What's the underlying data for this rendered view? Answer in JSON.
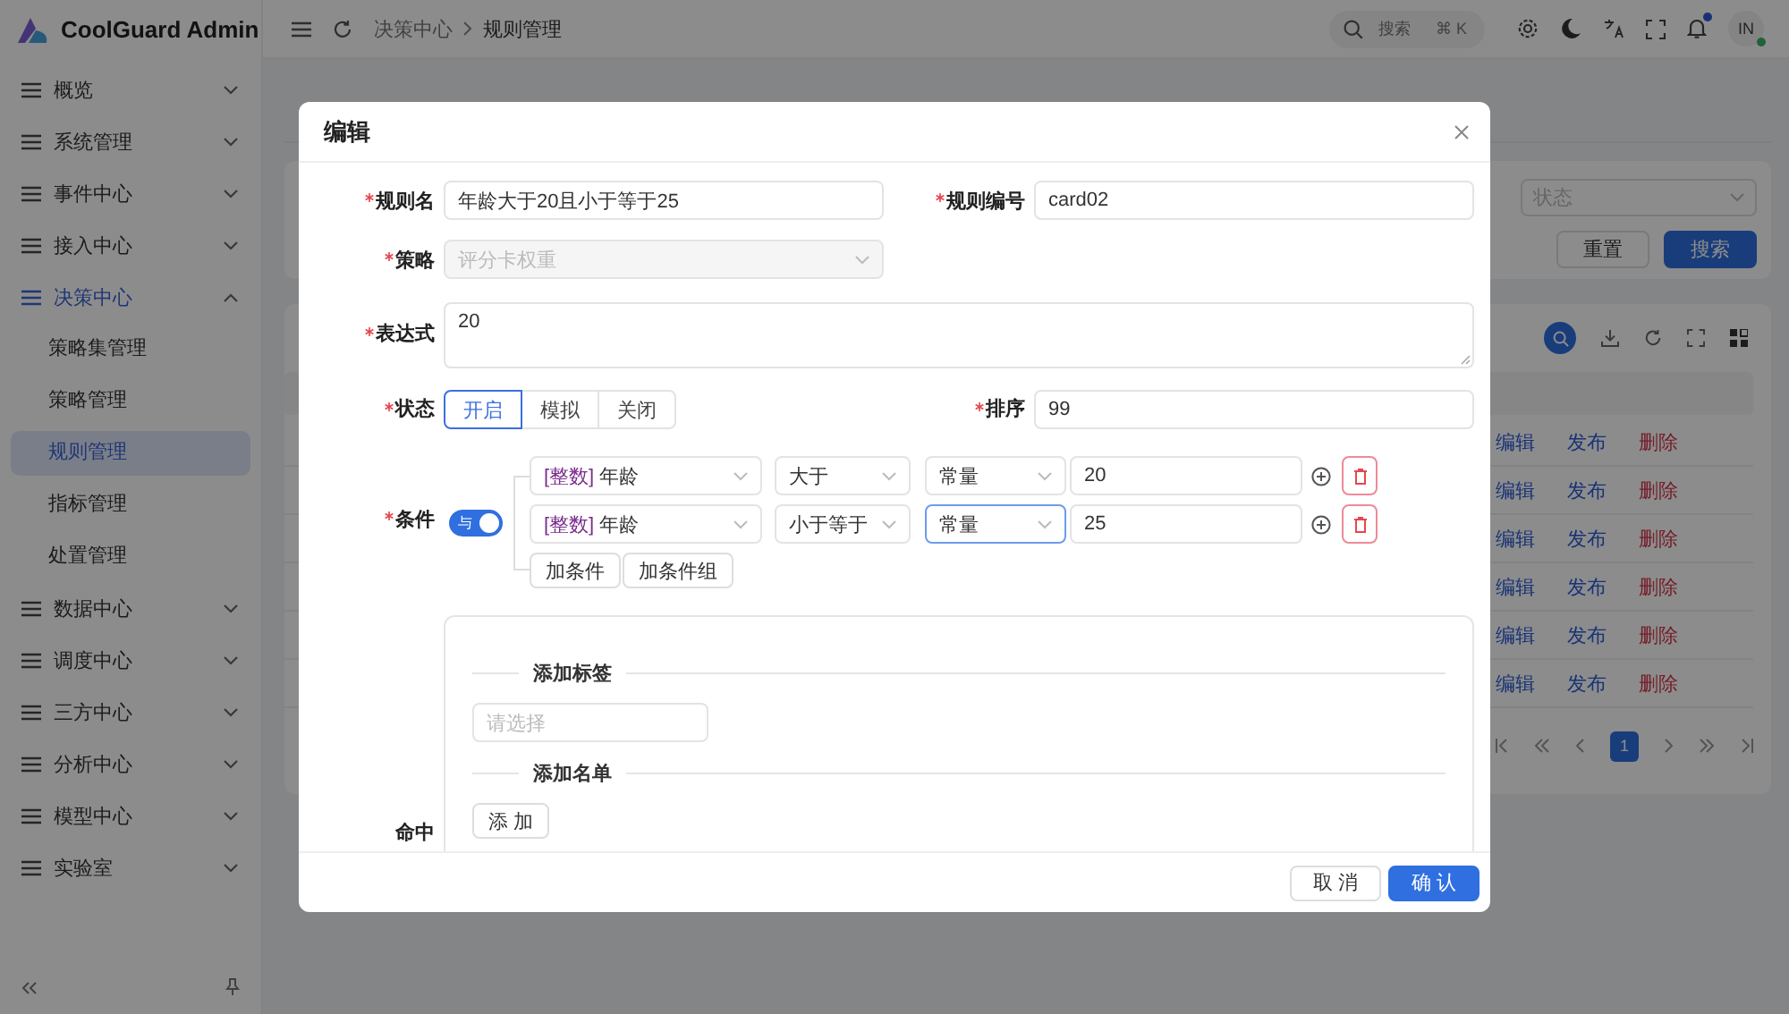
{
  "app": {
    "title": "CoolGuard Admin"
  },
  "header": {
    "breadcrumb": [
      "决策中心",
      "规则管理"
    ],
    "search": {
      "placeholder": "搜索",
      "shortcut": "⌘ K"
    },
    "unread": true,
    "avatar": {
      "initials": "IN",
      "online": true
    }
  },
  "sidebar": {
    "items": [
      {
        "label": "概览",
        "expanded": false
      },
      {
        "label": "系统管理",
        "expanded": false
      },
      {
        "label": "事件中心",
        "expanded": false
      },
      {
        "label": "接入中心",
        "expanded": false
      },
      {
        "label": "决策中心",
        "expanded": true,
        "children": [
          {
            "label": "策略集管理",
            "selected": false
          },
          {
            "label": "策略管理",
            "selected": false
          },
          {
            "label": "规则管理",
            "selected": true
          },
          {
            "label": "指标管理",
            "selected": false
          },
          {
            "label": "处置管理",
            "selected": false
          }
        ]
      },
      {
        "label": "数据中心",
        "expanded": false
      },
      {
        "label": "调度中心",
        "expanded": false
      },
      {
        "label": "三方中心",
        "expanded": false
      },
      {
        "label": "分析中心",
        "expanded": false
      },
      {
        "label": "模型中心",
        "expanded": false
      },
      {
        "label": "实验室",
        "expanded": false
      }
    ]
  },
  "content": {
    "filter": {
      "status_placeholder": "状态",
      "buttons": [
        {
          "label": "重置",
          "kind": "default"
        },
        {
          "label": "搜索",
          "kind": "primary"
        }
      ]
    },
    "table": {
      "rows": [
        {
          "actions": [
            {
              "label": "编辑",
              "kind": "link"
            },
            {
              "label": "发布",
              "kind": "link"
            },
            {
              "label": "删除",
              "kind": "danger"
            }
          ]
        },
        {
          "actions": [
            {
              "label": "编辑",
              "kind": "link"
            },
            {
              "label": "发布",
              "kind": "link"
            },
            {
              "label": "删除",
              "kind": "danger"
            }
          ]
        },
        {
          "actions": [
            {
              "label": "编辑",
              "kind": "link"
            },
            {
              "label": "发布",
              "kind": "link"
            },
            {
              "label": "删除",
              "kind": "danger"
            }
          ]
        },
        {
          "actions": [
            {
              "label": "编辑",
              "kind": "link"
            },
            {
              "label": "发布",
              "kind": "link"
            },
            {
              "label": "删除",
              "kind": "danger"
            }
          ]
        },
        {
          "actions": [
            {
              "label": "编辑",
              "kind": "link"
            },
            {
              "label": "发布",
              "kind": "link"
            },
            {
              "label": "删除",
              "kind": "danger"
            }
          ]
        },
        {
          "actions": [
            {
              "label": "编辑",
              "kind": "link"
            },
            {
              "label": "发布",
              "kind": "link"
            },
            {
              "label": "删除",
              "kind": "danger"
            }
          ]
        }
      ]
    },
    "pagination": {
      "pages": [
        {
          "label": "1",
          "selected": true
        }
      ]
    }
  },
  "dialog": {
    "title": "编辑",
    "rule_name": {
      "label": "规则名",
      "required": true,
      "value": "年龄大于20且小于等于25"
    },
    "rule_code": {
      "label": "规则编号",
      "required": true,
      "value": "card02"
    },
    "strategy": {
      "label": "策略",
      "required": true,
      "value": "评分卡权重",
      "disabled": true
    },
    "expression": {
      "label": "表达式",
      "required": true,
      "value": "20"
    },
    "status": {
      "label": "状态",
      "required": true,
      "options": [
        {
          "label": "开启",
          "selected": true
        },
        {
          "label": "模拟",
          "selected": false
        },
        {
          "label": "关闭",
          "selected": false
        }
      ]
    },
    "order": {
      "label": "排序",
      "required": true,
      "value": "99"
    },
    "conditions": {
      "label": "条件",
      "required": true,
      "logic": {
        "label": "与",
        "on": true
      },
      "rows": [
        {
          "field_type": "[整数]",
          "field": "年龄",
          "operator": "大于",
          "value_type": "常量",
          "value": "20",
          "focused": false
        },
        {
          "field_type": "[整数]",
          "field": "年龄",
          "operator": "小于等于",
          "value_type": "常量",
          "value": "25",
          "focused": true
        }
      ],
      "buttons": [
        "加条件",
        "加条件组"
      ]
    },
    "hit": {
      "label": "命中",
      "sections": [
        {
          "title": "添加标签",
          "kind": "select",
          "placeholder": "请选择"
        },
        {
          "title": "添加名单",
          "kind": "button",
          "button": "添 加"
        }
      ]
    },
    "footer_buttons": [
      {
        "label": "取 消",
        "kind": "default"
      },
      {
        "label": "确 认",
        "kind": "primary"
      }
    ]
  }
}
